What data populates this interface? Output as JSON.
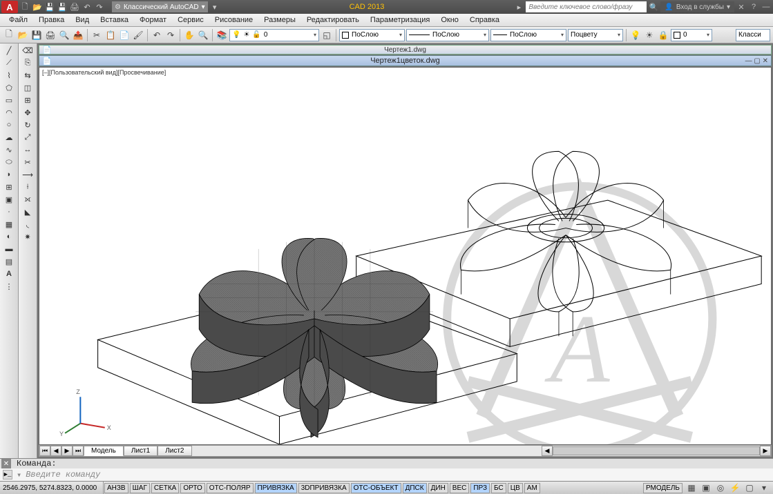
{
  "title_bar": {
    "workspace": "Классический AutoCAD",
    "app_name_center": "CAD 2013",
    "search_placeholder": "Введите ключевое слово/фразу",
    "login_label": "Вход в службы"
  },
  "menus": [
    "Файл",
    "Правка",
    "Вид",
    "Вставка",
    "Формат",
    "Сервис",
    "Рисование",
    "Размеры",
    "Редактировать",
    "Параметризация",
    "Окно",
    "Справка"
  ],
  "toolbar_layer": {
    "current": "0",
    "bylayer1": "ПоСлою",
    "bylayer2": "ПоСлою",
    "bylayer3": "ПоСлою",
    "bycolor": "Поцвету",
    "workspace_right": "Класси"
  },
  "documents": {
    "tab1": "Чертеж1.dwg",
    "tab2": "Чертеж1цветок.dwg",
    "vp_label": "[–][Пользовательский вид][Просвечивание]"
  },
  "layout_tabs": [
    "Модель",
    "Лист1",
    "Лист2"
  ],
  "command": {
    "hist": "Команда:",
    "placeholder": "Введите команду"
  },
  "status": {
    "coords": "2546.2975, 5274.8323, 0.0000",
    "buttons": [
      "АНЗВ",
      "ШАГ",
      "СЕТКА",
      "ОРТО",
      "ОТС-ПОЛЯР",
      "ПРИВЯЗКА",
      "3DПРИВЯЗКА",
      "ОТС-ОБЪЕКТ",
      "ДПСК",
      "ДИН",
      "ВЕС",
      "ПРЗ",
      "БС",
      "ЦВ",
      "АМ"
    ],
    "actives": [
      false,
      false,
      false,
      false,
      false,
      true,
      false,
      true,
      true,
      false,
      false,
      true,
      false,
      false,
      false
    ],
    "right_label": "РМОДЕЛЬ"
  }
}
